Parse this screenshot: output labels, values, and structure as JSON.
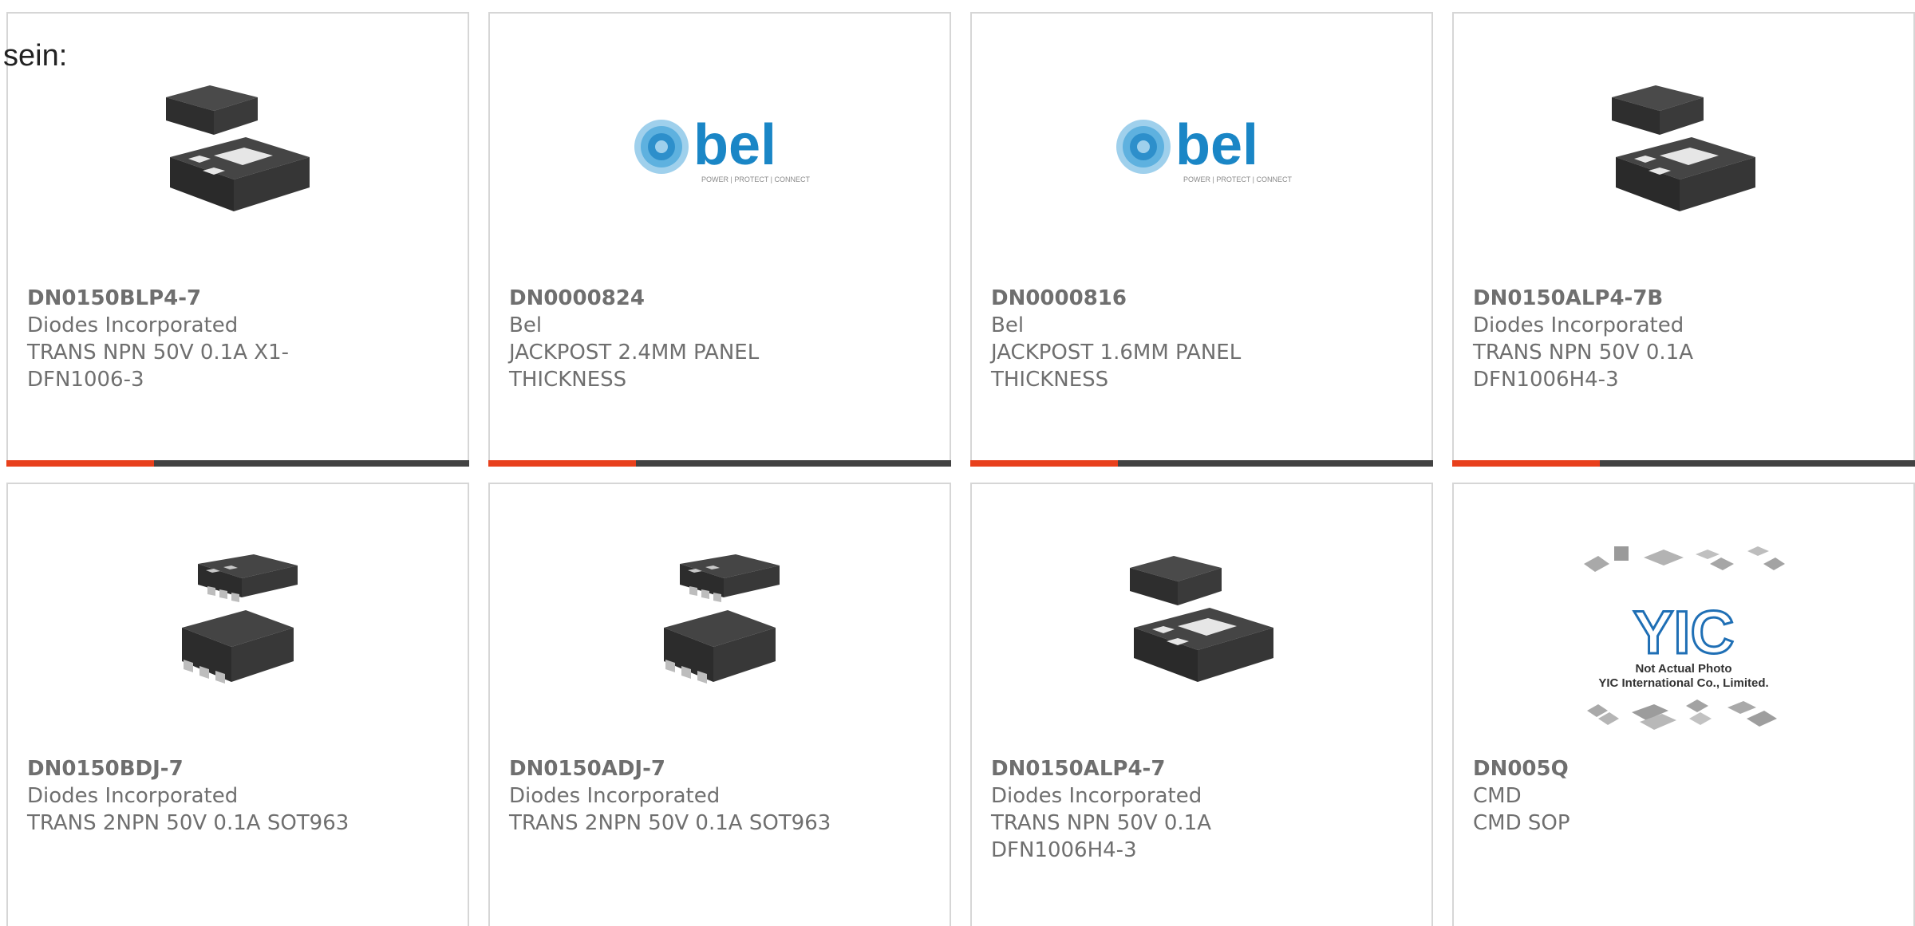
{
  "intro_text": "sein:",
  "colors": {
    "accent": "#e8401c",
    "bar": "#424242",
    "text": "#6f6f6f",
    "border": "#d6d6d6",
    "bel_blue": "#1a86c6"
  },
  "products": [
    {
      "part": "DN0150BLP4-7",
      "mfr": "Diodes Incorporated",
      "desc": "TRANS NPN 50V 0.1A X1-DFN1006-3",
      "image": "dfn-package-icon"
    },
    {
      "part": "DN0000824",
      "mfr": "Bel",
      "desc": "JACKPOST 2.4MM PANEL THICKNESS",
      "image": "bel-logo",
      "logo_text": "bel",
      "logo_tagline": "POWER | PROTECT | CONNECT"
    },
    {
      "part": "DN0000816",
      "mfr": "Bel",
      "desc": "JACKPOST 1.6MM PANEL THICKNESS",
      "image": "bel-logo",
      "logo_text": "bel",
      "logo_tagline": "POWER | PROTECT | CONNECT"
    },
    {
      "part": "DN0150ALP4-7B",
      "mfr": "Diodes Incorporated",
      "desc": "TRANS NPN 50V 0.1A DFN1006H4-3",
      "image": "dfn-package-icon"
    },
    {
      "part": "DN0150BDJ-7",
      "mfr": "Diodes Incorporated",
      "desc": "TRANS 2NPN 50V 0.1A SOT963",
      "image": "sot963-package-icon"
    },
    {
      "part": "DN0150ADJ-7",
      "mfr": "Diodes Incorporated",
      "desc": "TRANS 2NPN 50V 0.1A SOT963",
      "image": "sot963-package-icon"
    },
    {
      "part": "DN0150ALP4-7",
      "mfr": "Diodes Incorporated",
      "desc": "TRANS NPN 50V 0.1A DFN1006H4-3",
      "image": "dfn-package-icon"
    },
    {
      "part": "DN005Q",
      "mfr": "CMD",
      "desc": "CMD SOP",
      "image": "yic-placeholder-icon",
      "logo_text": "YIC",
      "caption_1": "Not Actual Photo",
      "caption_2": "YIC International Co., Limited."
    }
  ]
}
